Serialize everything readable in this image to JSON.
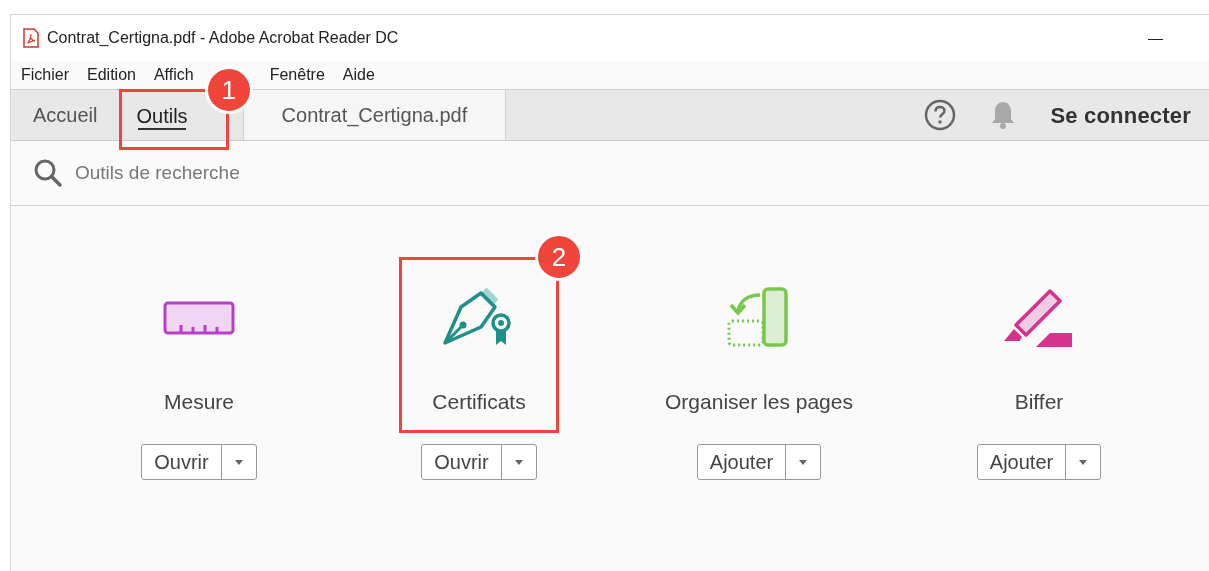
{
  "window": {
    "title": "Contrat_Certigna.pdf - Adobe Acrobat Reader DC",
    "minimize": "—"
  },
  "menu": [
    "Fichier",
    "Edition",
    "Affich",
    "Fenêtre",
    "Aide"
  ],
  "tabs": [
    {
      "label": "Accueil",
      "selected": false
    },
    {
      "label": "Outils",
      "selected": true,
      "callout": "1"
    },
    {
      "label": "Contrat_Certigna.pdf",
      "selected": false,
      "kind": "document"
    }
  ],
  "account": {
    "sign_in": "Se connecter"
  },
  "search": {
    "placeholder": "Outils de recherche"
  },
  "tools": [
    {
      "name": "Mesure",
      "kind": "ruler",
      "action": "Ouvrir"
    },
    {
      "name": "Certificats",
      "kind": "pen",
      "action": "Ouvrir",
      "callout": "2"
    },
    {
      "name": "Organiser les pages",
      "kind": "organize",
      "action": "Ajouter"
    },
    {
      "name": "Biffer",
      "kind": "strike",
      "action": "Ajouter"
    }
  ]
}
